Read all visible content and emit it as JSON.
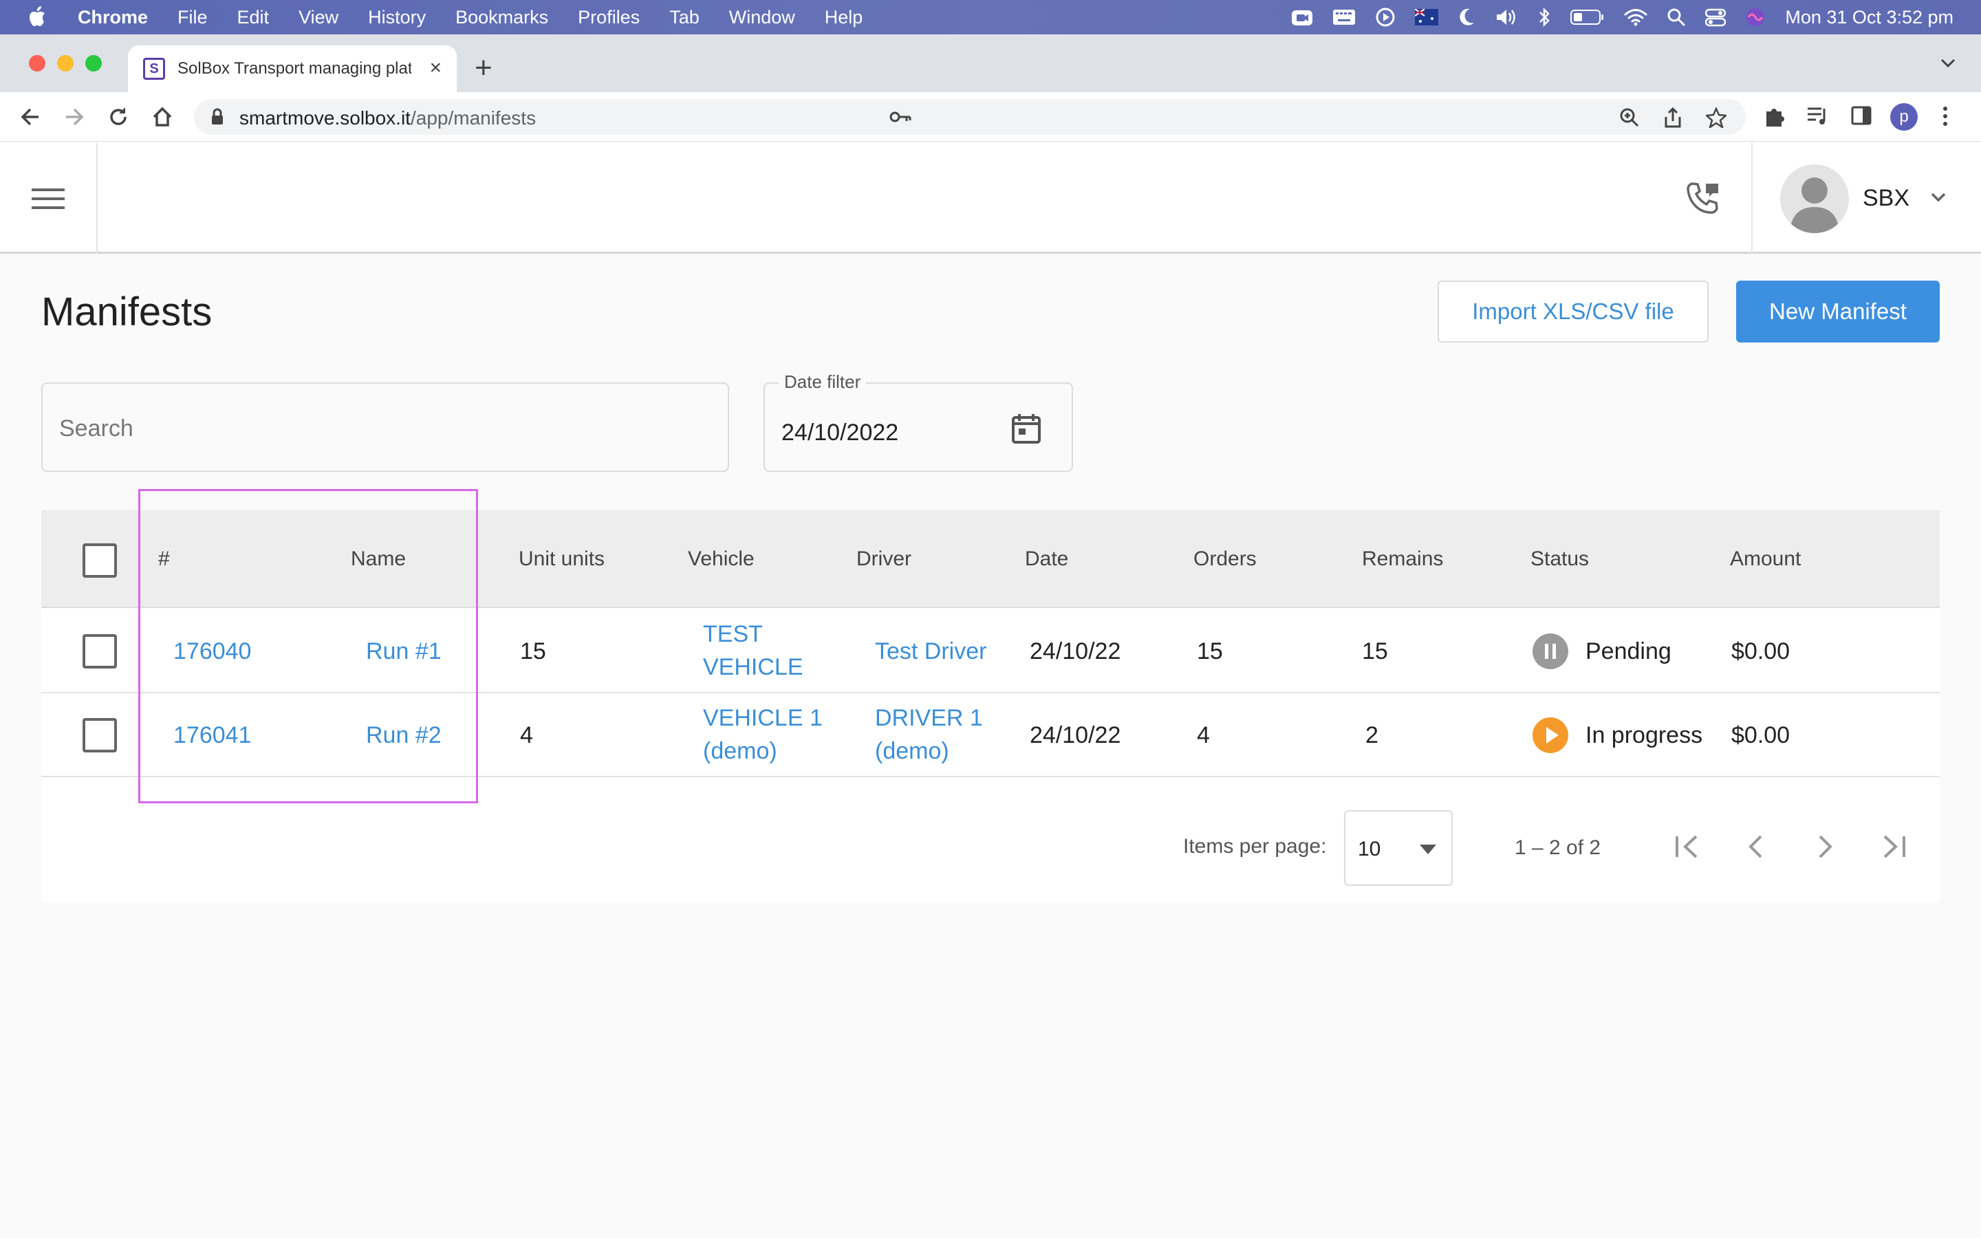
{
  "menubar": {
    "app_name": "Chrome",
    "items": [
      "File",
      "Edit",
      "View",
      "History",
      "Bookmarks",
      "Profiles",
      "Tab",
      "Window",
      "Help"
    ],
    "clock": "Mon 31 Oct  3:52 pm"
  },
  "browser": {
    "tab_title": "SolBox Transport managing platform",
    "favicon_letter": "S",
    "url_host": "smartmove.solbox.it",
    "url_path": "/app/manifests",
    "profile_initial": "p"
  },
  "header": {
    "user_name": "SBX"
  },
  "page": {
    "title": "Manifests",
    "import_label": "Import XLS/CSV file",
    "new_label": "New Manifest"
  },
  "filters": {
    "search_placeholder": "Search",
    "date_label": "Date filter",
    "date_value": "24/10/2022"
  },
  "table": {
    "columns": [
      "#",
      "Name",
      "Unit units",
      "Vehicle",
      "Driver",
      "Date",
      "Orders",
      "Remains",
      "Status",
      "Amount"
    ],
    "rows": [
      {
        "id": "176040",
        "name": "Run #1",
        "units": "15",
        "vehicle_l1": "TEST",
        "vehicle_l2": "VEHICLE",
        "driver_l1": "Test Driver",
        "driver_l2": "",
        "date": "24/10/22",
        "orders": "15",
        "remains": "15",
        "status": "Pending",
        "status_color": "#9a9a9a",
        "amount": "$0.00"
      },
      {
        "id": "176041",
        "name": "Run #2",
        "units": "4",
        "vehicle_l1": "VEHICLE 1",
        "vehicle_l2": "(demo)",
        "driver_l1": "DRIVER 1",
        "driver_l2": "(demo)",
        "date": "24/10/22",
        "orders": "4",
        "remains": "2",
        "status": "In progress",
        "status_color": "#f39a2a",
        "amount": "$0.00"
      }
    ]
  },
  "pager": {
    "items_per_page_label": "Items per page:",
    "items_per_page": "10",
    "range": "1 – 2 of 2"
  },
  "colors": {
    "accent": "#3d8fe0",
    "link": "#3b8ed6",
    "highlight": "#d568e8"
  }
}
